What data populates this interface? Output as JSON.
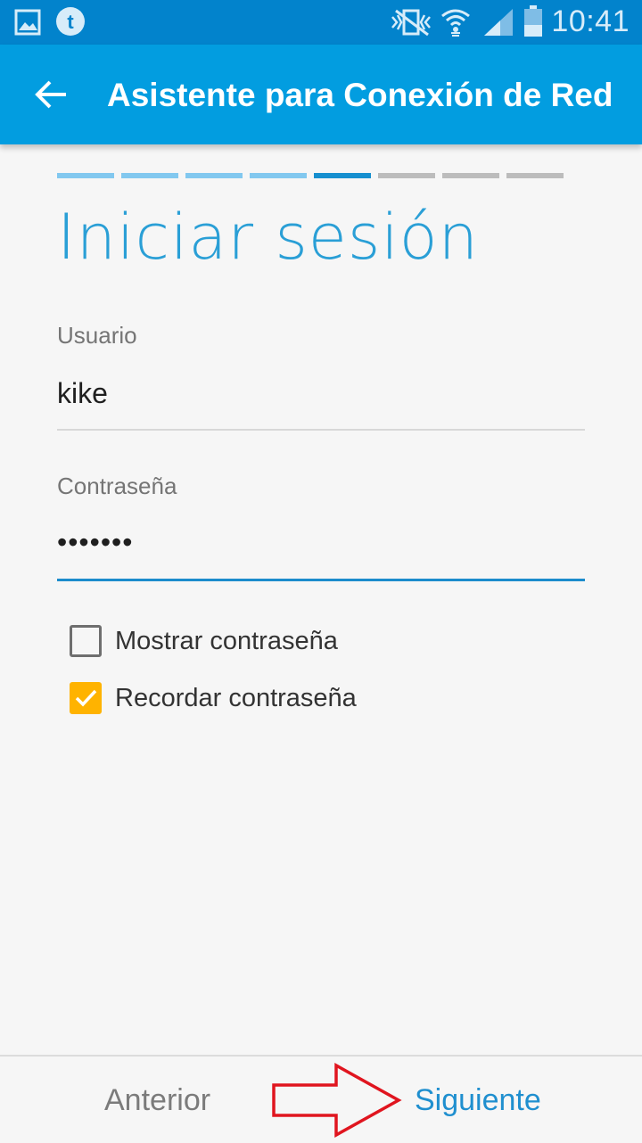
{
  "status_bar": {
    "time": "10:41",
    "icons": [
      "gallery-icon",
      "tumblr-icon",
      "vibrate-mute-icon",
      "wifi-icon",
      "signal-icon",
      "battery-icon"
    ]
  },
  "app_bar": {
    "title": "Asistente para Conexión de Red",
    "back_icon": "arrow-back-icon"
  },
  "progress": {
    "total_steps": 8,
    "current_step": 5
  },
  "page_title": "Iniciar sesión",
  "form": {
    "username_label": "Usuario",
    "username_value": "kike",
    "password_label": "Contraseña",
    "password_value": "•••••••"
  },
  "options": {
    "show_password_label": "Mostrar contraseña",
    "show_password_checked": false,
    "remember_password_label": "Recordar contraseña",
    "remember_password_checked": true
  },
  "footer": {
    "previous_label": "Anterior",
    "next_label": "Siguiente"
  },
  "colors": {
    "status_bar": "#0283cc",
    "app_bar": "#029de0",
    "accent": "#1c8ccc",
    "checkbox_checked": "#ffb300",
    "annotation_arrow": "#e0151f"
  }
}
